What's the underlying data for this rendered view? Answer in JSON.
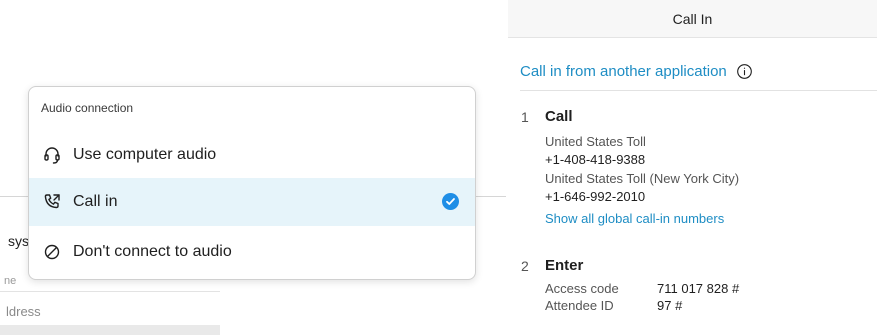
{
  "background": {
    "partial_label_sys": "sys",
    "partial_field_label": "ne",
    "partial_address_label": "ldress"
  },
  "audio_menu": {
    "title": "Audio connection",
    "items": [
      {
        "label": "Use computer audio",
        "icon": "headset-icon",
        "selected": false
      },
      {
        "label": "Call in",
        "icon": "phone-call-icon",
        "selected": true
      },
      {
        "label": "Don't connect to audio",
        "icon": "no-audio-icon",
        "selected": false
      }
    ],
    "accent_color": "#1f8ee6",
    "selected_bg": "#e6f4fa"
  },
  "call_in_panel": {
    "title": "Call In",
    "other_app_link": "Call in from another application",
    "step1": {
      "number": "1",
      "title": "Call",
      "numbers": [
        {
          "label": "United States Toll",
          "phone": "+1-408-418-9388"
        },
        {
          "label": "United States Toll (New York City)",
          "phone": "+1-646-992-2010"
        }
      ],
      "show_all_link": "Show all global call-in numbers"
    },
    "step2": {
      "number": "2",
      "title": "Enter",
      "access_code_label": "Access code",
      "access_code": "711 017 828 #",
      "attendee_id_label": "Attendee ID",
      "attendee_id": "97 #"
    },
    "link_color": "#1e8dc4"
  }
}
